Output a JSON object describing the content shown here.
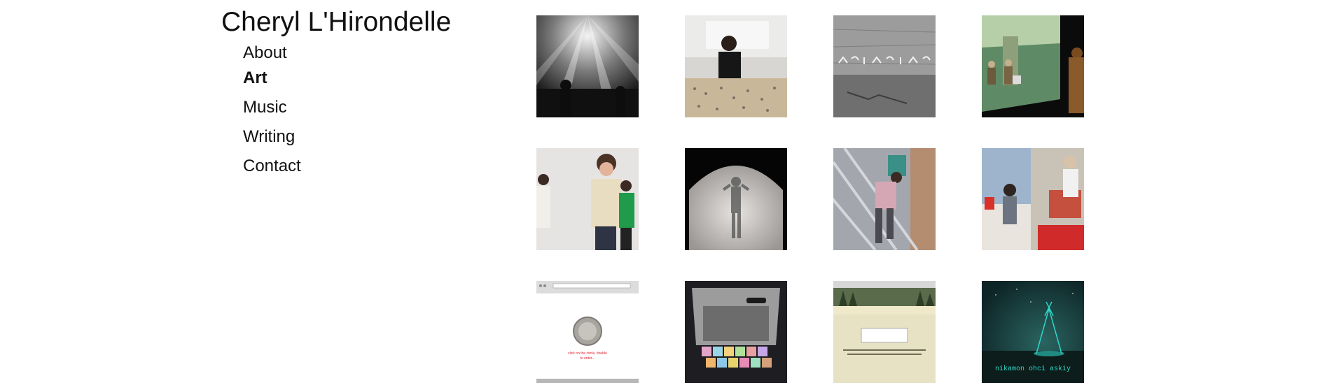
{
  "site": {
    "title": "Cheryl L'Hirondelle"
  },
  "nav": {
    "items": [
      {
        "label": "About"
      },
      {
        "label": "Art",
        "active": true
      },
      {
        "label": "Music"
      },
      {
        "label": "Writing"
      },
      {
        "label": "Contact"
      }
    ]
  },
  "gallery": {
    "thumbnails": [
      {
        "icon": "concert-lights-photo"
      },
      {
        "icon": "performer-table-photo"
      },
      {
        "icon": "stone-wall-syllabics-photo"
      },
      {
        "icon": "projection-screen-photo"
      },
      {
        "icon": "gallery-visitors-photo"
      },
      {
        "icon": "silhouette-tent-photo"
      },
      {
        "icon": "climbing-railing-photo"
      },
      {
        "icon": "canada-flags-photo"
      },
      {
        "icon": "website-screenshot-medallion"
      },
      {
        "icon": "car-window-blocks-photo"
      },
      {
        "icon": "website-screenshot-forest"
      },
      {
        "icon": "tipi-night-sky-artwork"
      }
    ],
    "screenshot_texts": {
      "medallion_caption": "click on the circle, double\nto enter...",
      "tipi_caption": "nikamon ohci askiy"
    },
    "accent_colors": {
      "teal": "#2fd6c8",
      "red": "#e0202a"
    }
  }
}
